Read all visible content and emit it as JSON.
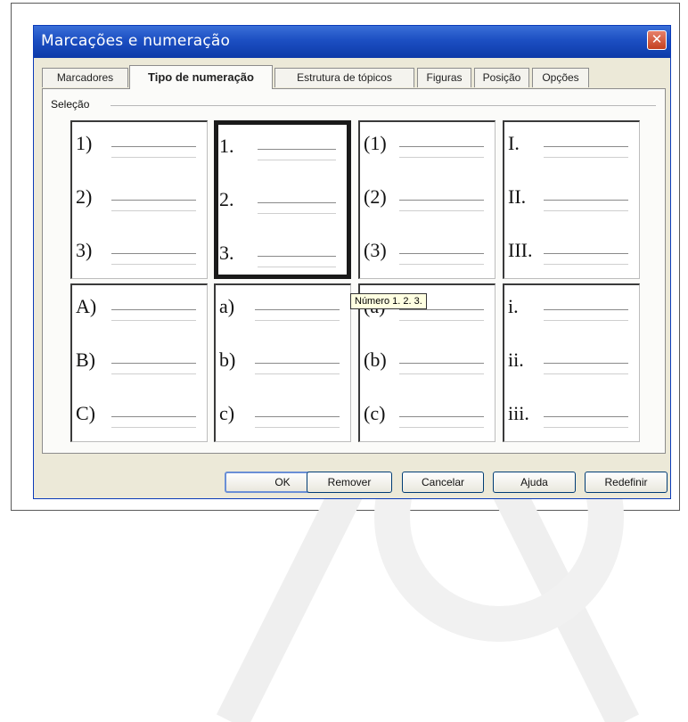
{
  "dialog": {
    "title": "Marcações e numeração",
    "close_glyph": "✕",
    "tabs": [
      {
        "label": "Marcadores"
      },
      {
        "label": "Tipo de numeração"
      },
      {
        "label": "Estrutura de tópicos"
      },
      {
        "label": "Figuras"
      },
      {
        "label": "Posição"
      },
      {
        "label": "Opções"
      }
    ],
    "active_tab": "Tipo de numeração",
    "section_label": "Seleção",
    "numbering_styles": [
      {
        "items": [
          "1)",
          "2)",
          "3)"
        ]
      },
      {
        "items": [
          "1.",
          "2.",
          "3."
        ],
        "selected": true
      },
      {
        "items": [
          "(1)",
          "(2)",
          "(3)"
        ]
      },
      {
        "items": [
          "I.",
          "II.",
          "III."
        ]
      },
      {
        "items": [
          "A)",
          "B)",
          "C)"
        ]
      },
      {
        "items": [
          "a)",
          "b)",
          "c)"
        ]
      },
      {
        "items": [
          "(a)",
          "(b)",
          "(c)"
        ]
      },
      {
        "items": [
          "i.",
          "ii.",
          "iii."
        ]
      }
    ],
    "tooltip": "Número 1. 2. 3.",
    "buttons": {
      "ok": "OK",
      "remove": "Remover",
      "cancel": "Cancelar",
      "help": "Ajuda",
      "reset": "Redefinir"
    }
  },
  "colors": {
    "title_bar": "#1c4fc2",
    "close_button": "#d0502e",
    "dialog_bg": "#ece9d8",
    "tooltip_bg": "#ffffe1"
  }
}
